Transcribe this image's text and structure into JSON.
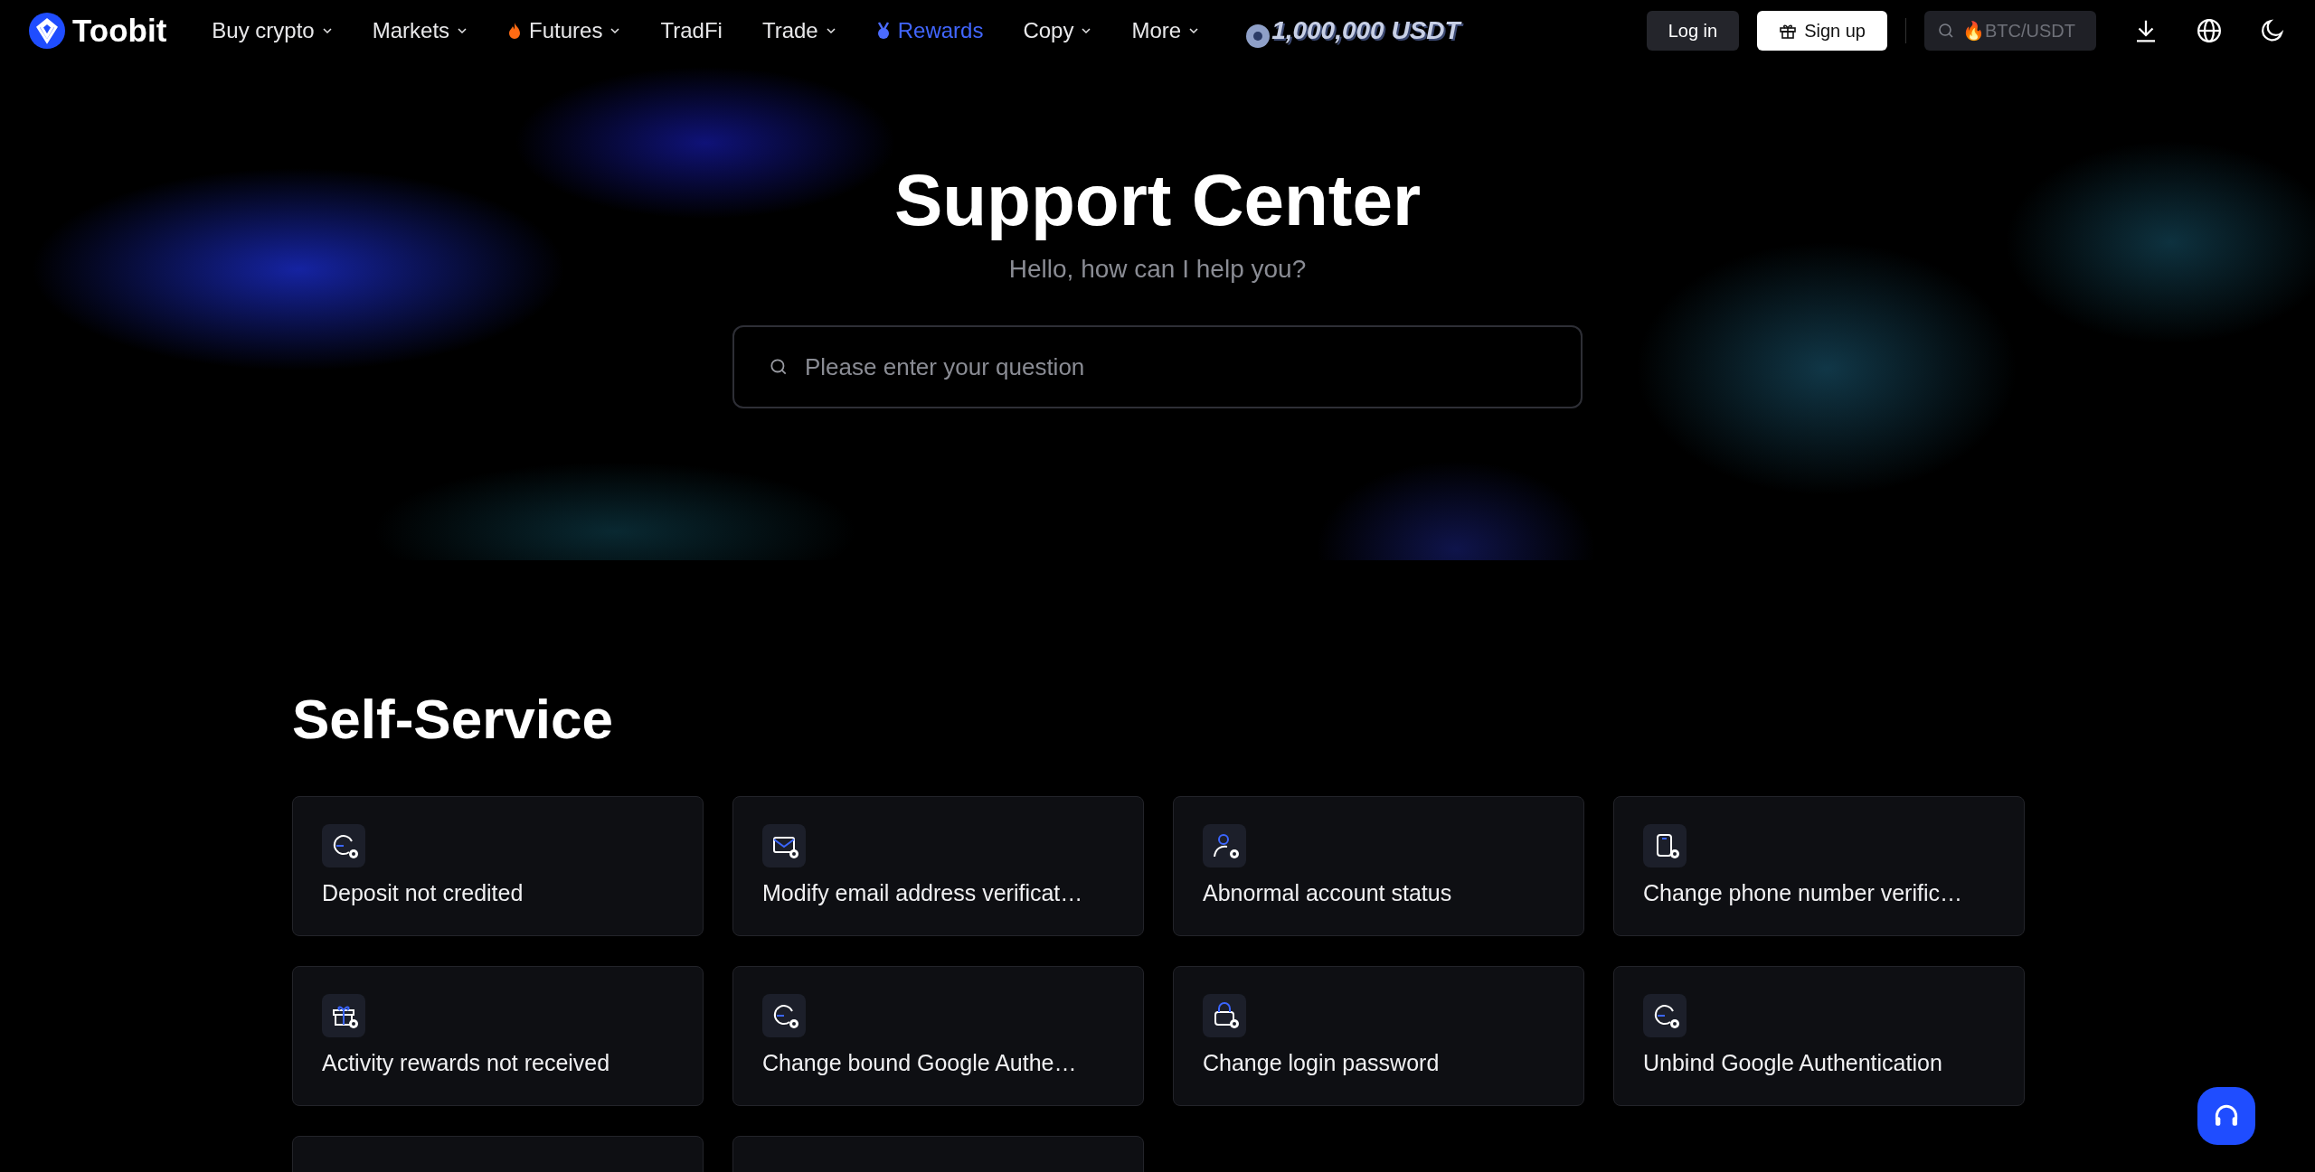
{
  "header": {
    "logo": "Toobit",
    "nav": [
      {
        "label": "Buy crypto",
        "kind": "plain",
        "dropdown": true,
        "highlighted": false
      },
      {
        "label": "Markets",
        "kind": "plain",
        "dropdown": true,
        "highlighted": false
      },
      {
        "label": "Futures",
        "kind": "fire",
        "dropdown": true,
        "highlighted": false
      },
      {
        "label": "TradFi",
        "kind": "plain",
        "dropdown": false,
        "highlighted": false
      },
      {
        "label": "Trade",
        "kind": "plain",
        "dropdown": true,
        "highlighted": false
      },
      {
        "label": "Rewards",
        "kind": "medal",
        "dropdown": false,
        "highlighted": true
      },
      {
        "label": "Copy",
        "kind": "plain",
        "dropdown": true,
        "highlighted": false
      },
      {
        "label": "More",
        "kind": "plain",
        "dropdown": true,
        "highlighted": false
      }
    ],
    "promo": "1,000,000 USDT",
    "login": "Log in",
    "signup": "Sign up",
    "search": {
      "placeholder": "🔥BTC/USDT"
    }
  },
  "hero": {
    "title": "Support Center",
    "subtitle": "Hello, how can I help you?",
    "search": {
      "placeholder": "Please enter your question"
    }
  },
  "self_service": {
    "title": "Self-Service",
    "cards": [
      {
        "label": "Deposit not credited"
      },
      {
        "label": "Modify email address verificat…"
      },
      {
        "label": "Abnormal account status"
      },
      {
        "label": "Change phone number verific…"
      },
      {
        "label": "Activity rewards not received"
      },
      {
        "label": "Change bound Google Authe…"
      },
      {
        "label": "Change login password"
      },
      {
        "label": "Unbind Google Authentication"
      }
    ]
  }
}
